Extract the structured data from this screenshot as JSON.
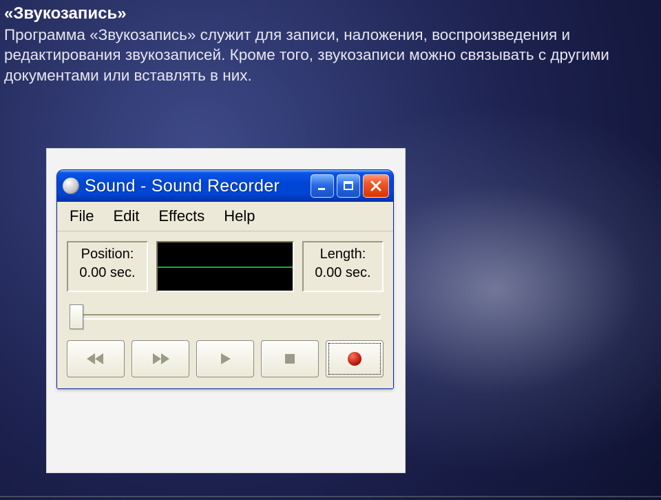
{
  "slide": {
    "title": "«Звукозапись»",
    "body": "Программа «Звукозапись» служит для записи, наложения, воспроизведения и редактирования звукозаписей. Кроме того, звукозаписи можно связывать с другими документами или вставлять в них."
  },
  "window": {
    "title": "Sound - Sound Recorder",
    "menu": {
      "file": "File",
      "edit": "Edit",
      "effects": "Effects",
      "help": "Help"
    },
    "position": {
      "label": "Position:",
      "value": "0.00 sec."
    },
    "length": {
      "label": "Length:",
      "value": "0.00 sec."
    },
    "buttons": {
      "seek_start": "seek-to-start",
      "seek_end": "seek-to-end",
      "play": "play",
      "stop": "stop",
      "record": "record"
    },
    "colors": {
      "titlebar": "#0046d5",
      "close": "#d83400",
      "wave_line": "#1fae1f"
    }
  }
}
